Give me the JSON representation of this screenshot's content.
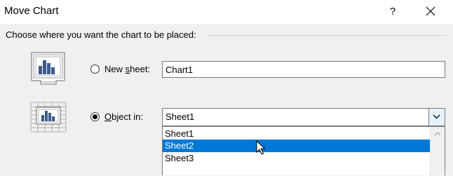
{
  "window": {
    "title": "Move Chart",
    "help_label": "?"
  },
  "prompt": "Choose where you want the chart to be placed:",
  "options": {
    "new_sheet": {
      "label_before": "New ",
      "label_accel": "s",
      "label_after": "heet:",
      "selected": false,
      "value": "Chart1"
    },
    "object_in": {
      "label_before": "",
      "label_accel": "O",
      "label_after": "bject in:",
      "selected": true,
      "value": "Sheet1"
    }
  },
  "dropdown": {
    "items": [
      "Sheet1",
      "Sheet2",
      "Sheet3"
    ],
    "highlighted_index": 1
  },
  "icons": {
    "new_sheet": "chart-sheet-icon",
    "object_in": "embedded-chart-icon",
    "close": "close-icon",
    "dropdown_arrow": "chevron-down-icon",
    "scroll_up": "chevron-up-icon",
    "cursor": "mouse-pointer-icon"
  },
  "colors": {
    "selection": "#0078d7",
    "dialog_bg": "#f0f0f0",
    "chart_bar": "#3c5a8c"
  }
}
